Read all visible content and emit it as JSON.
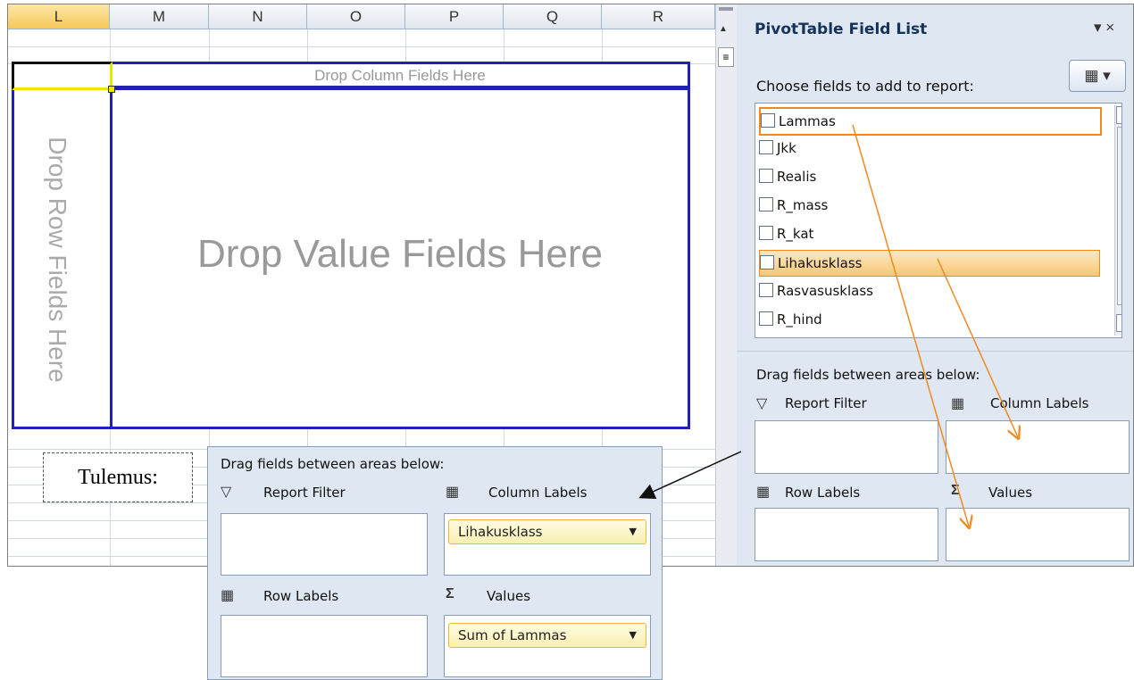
{
  "columns": [
    "L",
    "M",
    "N",
    "O",
    "P",
    "Q",
    "R"
  ],
  "pivot": {
    "column_drop": "Drop Column Fields Here",
    "row_drop": "Drop Row Fields Here",
    "value_drop": "Drop Value Fields Here"
  },
  "panel": {
    "title": "PivotTable Field List",
    "controls": "▾ ×",
    "choose_label": "Choose fields to add to report:",
    "fields": [
      "Lammas",
      "Jkk",
      "Realis",
      "R_mass",
      "R_kat",
      "Lihakusklass",
      "Rasvasusklass",
      "R_hind"
    ],
    "drag_label": "Drag fields between areas below:",
    "areas": {
      "report_filter": "Report Filter",
      "column_labels": "Column Labels",
      "row_labels": "Row Labels",
      "values": "Values"
    }
  },
  "result": {
    "label": "Tulemus:",
    "drag_label": "Drag fields between areas below:",
    "report_filter": "Report Filter",
    "column_labels": "Column Labels",
    "row_labels": "Row Labels",
    "values": "Values",
    "column_chip": "Lihakusklass",
    "value_chip": "Sum of Lammas"
  },
  "colors": {
    "pivot_border": "#1f22b5",
    "highlight": "#f08a20",
    "panel_bg": "#dfe7f2"
  }
}
